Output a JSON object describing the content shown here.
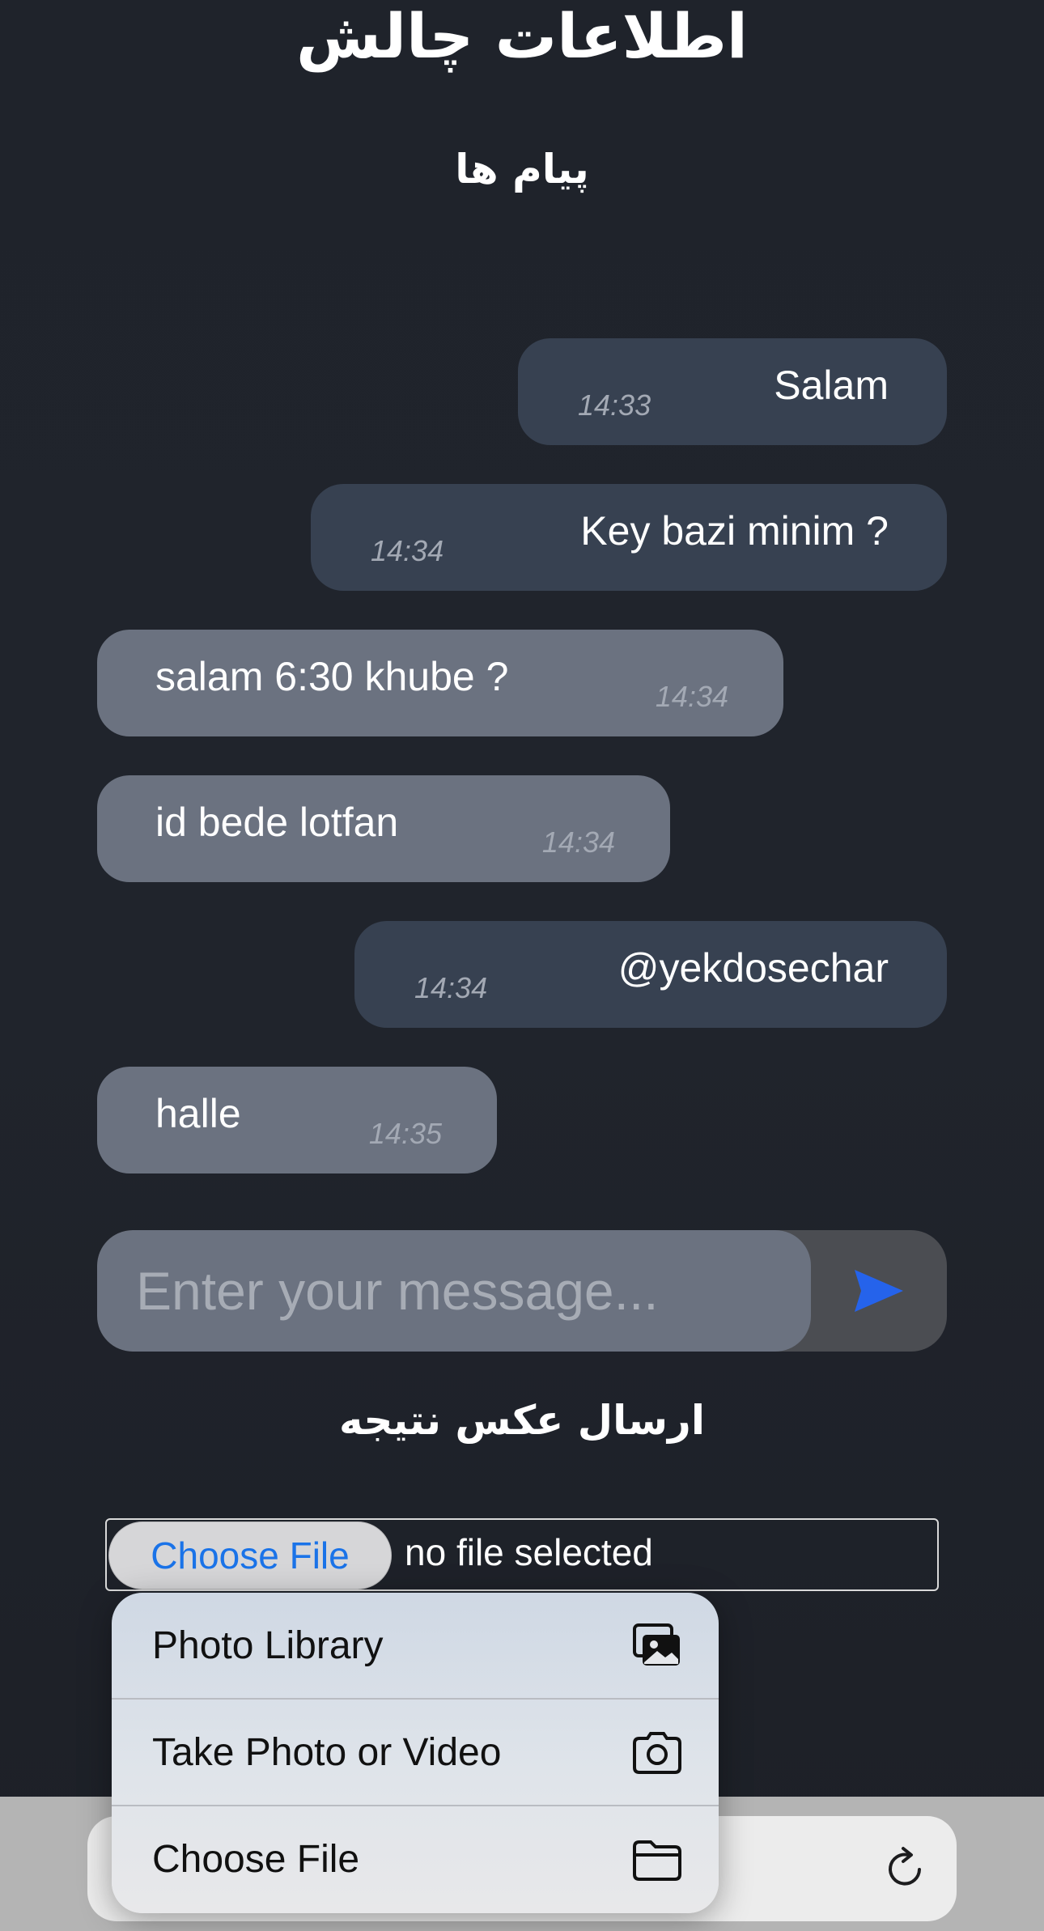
{
  "header": {
    "title": "اطلاعات چالش",
    "messages_title": "پیام ها"
  },
  "messages": [
    {
      "text": "Salam",
      "time": "14:33",
      "side": "sent"
    },
    {
      "text": "Key bazi minim ?",
      "time": "14:34",
      "side": "sent"
    },
    {
      "text": "salam 6:30 khube ?",
      "time": "14:34",
      "side": "received"
    },
    {
      "text": "id bede lotfan",
      "time": "14:34",
      "side": "received"
    },
    {
      "text": "@yekdosechar",
      "time": "14:34",
      "side": "sent"
    },
    {
      "text": "halle",
      "time": "14:35",
      "side": "received"
    }
  ],
  "composer": {
    "placeholder": "Enter your message...",
    "send_icon": "send-icon"
  },
  "upload": {
    "title": "ارسال عکس نتیجه",
    "choose_label": "Choose File",
    "status": "no file selected"
  },
  "file_menu": {
    "items": [
      {
        "label": "Photo Library",
        "icon": "photo-library-icon"
      },
      {
        "label": "Take Photo or Video",
        "icon": "camera-icon"
      },
      {
        "label": "Choose File",
        "icon": "folder-icon"
      }
    ]
  },
  "browser_bar": {
    "reload_icon": "reload-icon"
  },
  "colors": {
    "background": "#20242c",
    "sent_bubble": "#374151",
    "received_bubble": "#6b7280",
    "send_icon": "#2563eb",
    "choose_file_text": "#1a73e8"
  }
}
